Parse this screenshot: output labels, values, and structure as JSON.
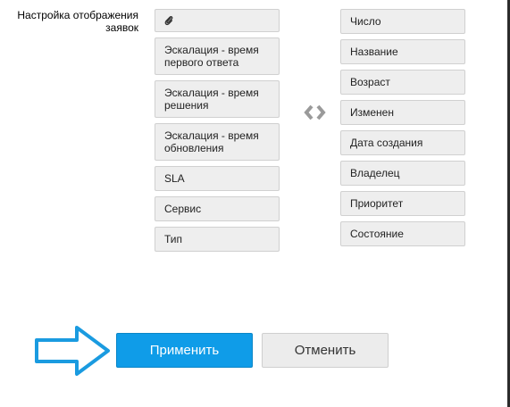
{
  "settings": {
    "label": "Настройка отображения заявок"
  },
  "available_columns": [
    {
      "label": "",
      "icon": "paperclip-icon"
    },
    {
      "label": "Эскалация - время первого ответа"
    },
    {
      "label": "Эскалация - время решения"
    },
    {
      "label": "Эскалация - время обновления"
    },
    {
      "label": "SLA"
    },
    {
      "label": "Сервис"
    },
    {
      "label": "Тип"
    }
  ],
  "selected_columns": [
    {
      "label": "Число"
    },
    {
      "label": "Название"
    },
    {
      "label": "Возраст"
    },
    {
      "label": "Изменен"
    },
    {
      "label": "Дата создания"
    },
    {
      "label": "Владелец"
    },
    {
      "label": "Приоритет"
    },
    {
      "label": "Состояние"
    }
  ],
  "actions": {
    "apply_label": "Применить",
    "cancel_label": "Отменить"
  },
  "colors": {
    "apply_bg": "#0f9ce8",
    "annotation_arrow": "#1a9be0",
    "chip_bg": "#eeeeee"
  },
  "icons": [
    "paperclip-icon",
    "swap-arrows-icon",
    "pointer-arrow-icon"
  ]
}
